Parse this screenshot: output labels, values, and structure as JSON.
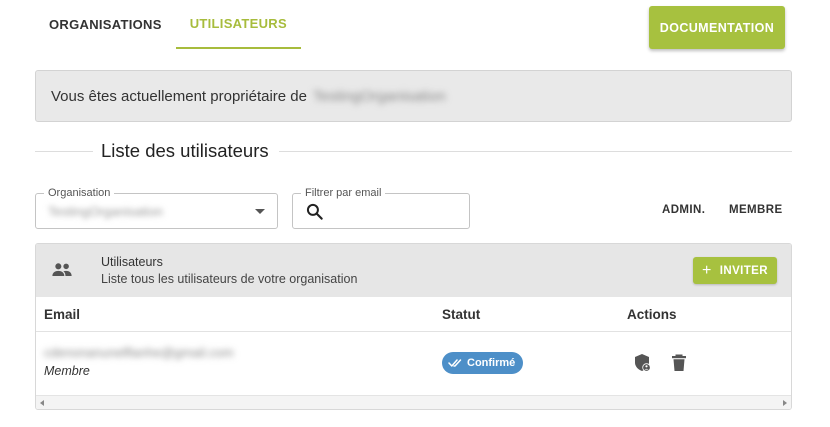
{
  "tabs": [
    {
      "label": "ORGANISATIONS",
      "active": false
    },
    {
      "label": "UTILISATEURS",
      "active": true
    }
  ],
  "header": {
    "documentation_label": "DOCUMENTATION"
  },
  "owner_banner": {
    "text": "Vous êtes actuellement propriétaire de",
    "organisation_name": "TestingOrganisation"
  },
  "section": {
    "title": "Liste des utilisateurs"
  },
  "filters": {
    "organisation": {
      "label": "Organisation",
      "value": "TestingOrganisation"
    },
    "email": {
      "label": "Filtrer par email",
      "value": "",
      "icon": "search-icon"
    }
  },
  "roles": {
    "admin_label": "ADMIN.",
    "member_label": "MEMBRE"
  },
  "card": {
    "icon": "people-icon",
    "title": "Utilisateurs",
    "subtitle": "Liste tous les utilisateurs de votre organisation",
    "invite_label": "INVITER"
  },
  "table": {
    "columns": [
      "Email",
      "Statut",
      "Actions"
    ],
    "rows": [
      {
        "email": "cdenonanunelflanhe@gmail.com",
        "role": "Membre",
        "status": "Confirmé",
        "actions": [
          "shield-user-icon",
          "trash-icon"
        ]
      }
    ]
  },
  "colors": {
    "accent": "#a7c13f",
    "status_confirmed": "#4d8fc8",
    "banner_bg": "#e9e9e9"
  }
}
